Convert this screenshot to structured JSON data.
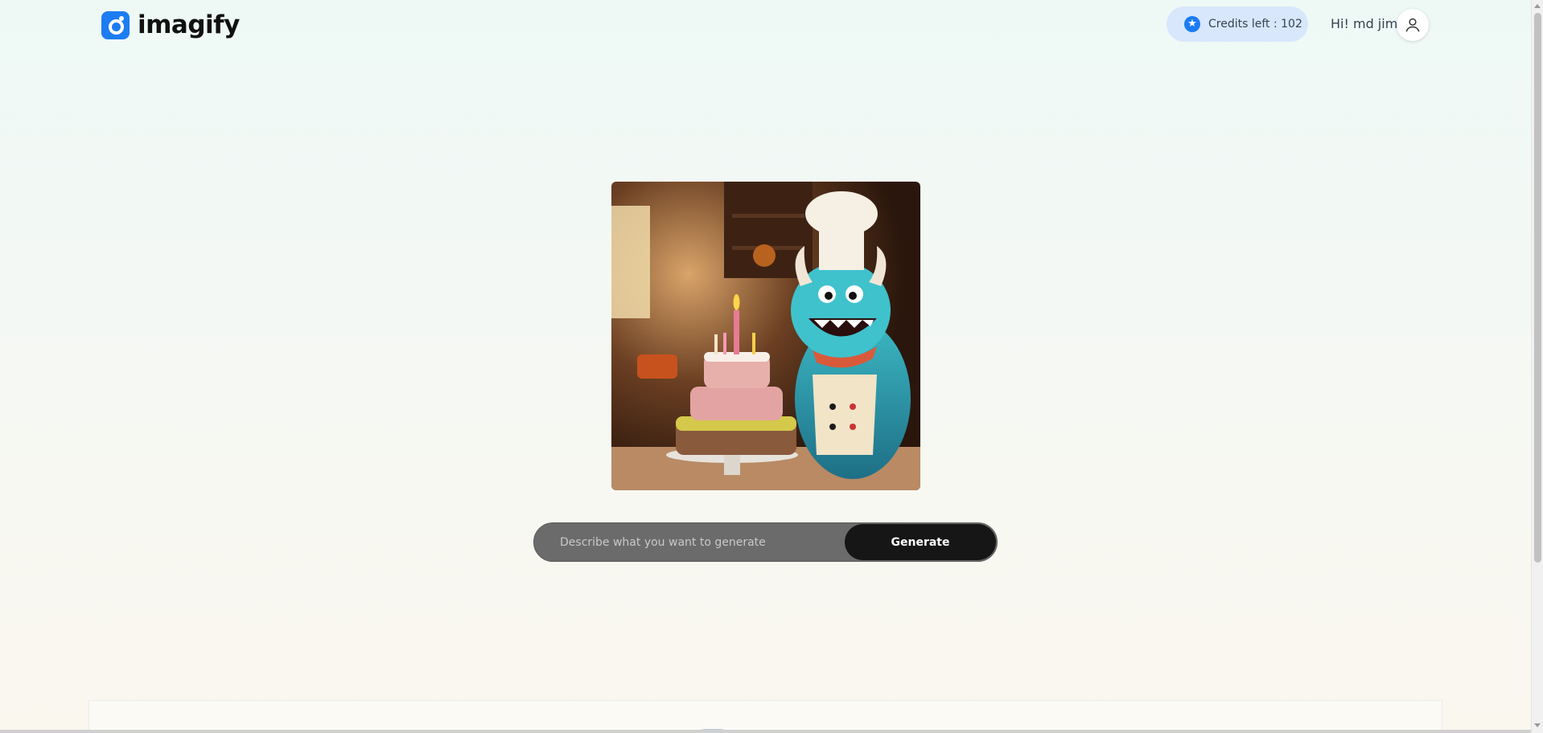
{
  "header": {
    "logo_text": "imagify",
    "credits_label": "Credits left : 102",
    "greeting": "Hi! md jim"
  },
  "hero": {
    "image_alt": "3D monster chef with birthday cake in kitchen"
  },
  "prompt": {
    "placeholder": "Describe what you want to generate",
    "value": "",
    "button_label": "Generate"
  },
  "icons": {
    "logo": "imagify-logo-icon",
    "credits": "star-icon",
    "avatar": "user-icon"
  },
  "colors": {
    "accent": "#1c7cf2",
    "credits_bg": "#d8e7fb",
    "button_bg": "#161616",
    "input_bg": "#6b6b6b"
  }
}
